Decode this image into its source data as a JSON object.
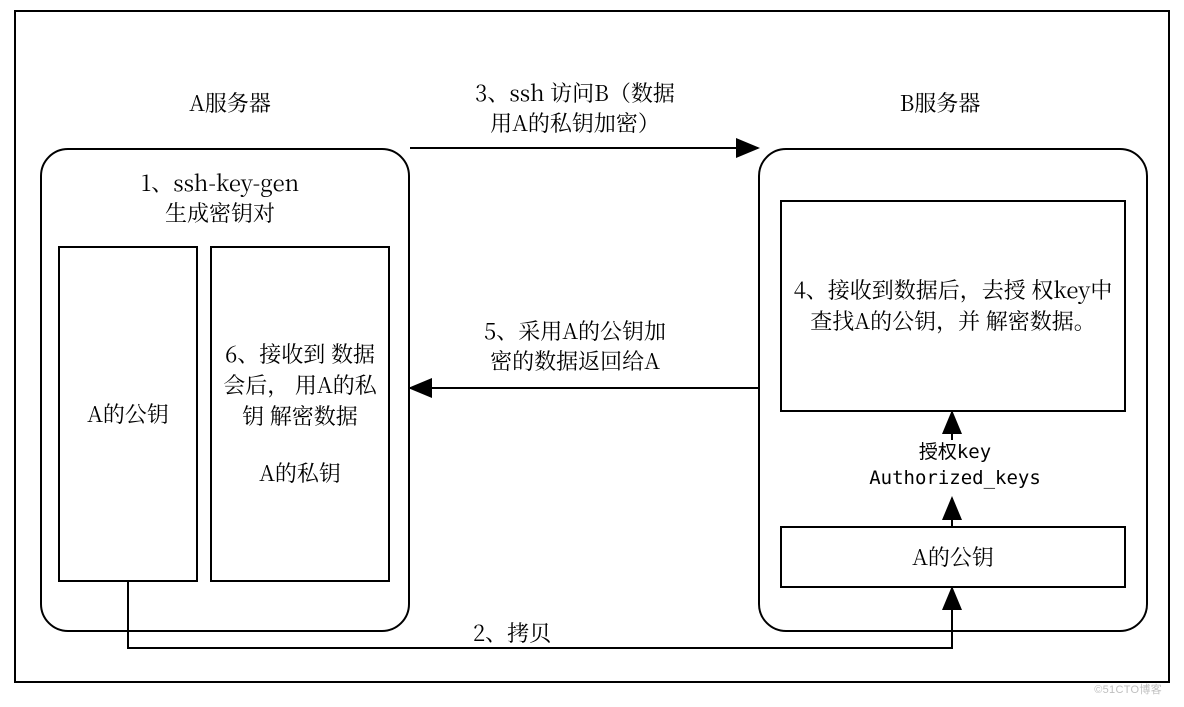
{
  "titles": {
    "serverA": "A服务器",
    "serverB": "B服务器"
  },
  "steps": {
    "s1": "1、ssh-key-gen\n生成密钥对",
    "s2": "2、拷贝",
    "s3": "3、ssh 访问B（数据\n用A的私钥加密）",
    "s4": "4、接收到数据后，去授\n权key中查找A的公钥，并\n解密数据。",
    "s5": "5、采用A的公钥加\n密的数据返回给A",
    "s6_top": "6、接收到\n数据会后，\n用A的私钥\n解密数据",
    "s6_bottom": "A的私钥"
  },
  "boxes": {
    "aPublicKey": "A的公钥",
    "bPublicKey": "A的公钥",
    "authKeyLabel": "授权key\nAuthorized_keys"
  },
  "watermark": "©51CTO博客"
}
